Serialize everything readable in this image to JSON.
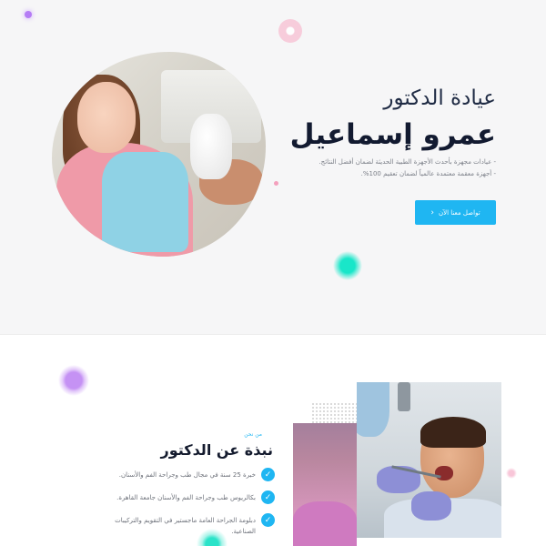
{
  "hero": {
    "title_line1": "عيادة الدكتور",
    "title_line2": "عمرو إسماعيل",
    "features": [
      "- عيادات مجهزة بأحدث الأجهزة الطبية الحديثة لضمان أفضل النتائج.",
      "- أجهزة معقمة معتمدة عالمياً لضمان تعقيم 100%."
    ],
    "cta_label": "تواصل معنا الآن",
    "cta_icon": "chevron-left-icon",
    "image_alt": "child-holding-tooth-model-photo"
  },
  "about": {
    "subtitle": "من نحن",
    "title": "نبذة عن الدكتور",
    "items": [
      "خبرة 25 سنة في مجال طب وجراحة الفم والأسنان.",
      "بكالريوس طب وجراحة الفم والأسنان جامعة القاهرة.",
      "دبلومة الجراحة العامة ماجستير في التقويم والتركيبات الصناعية."
    ],
    "item_icon": "check-icon"
  },
  "colors": {
    "accent": "#1fb6f2",
    "heading": "#1f2b44",
    "hero_bg": "#f6f6f7"
  }
}
